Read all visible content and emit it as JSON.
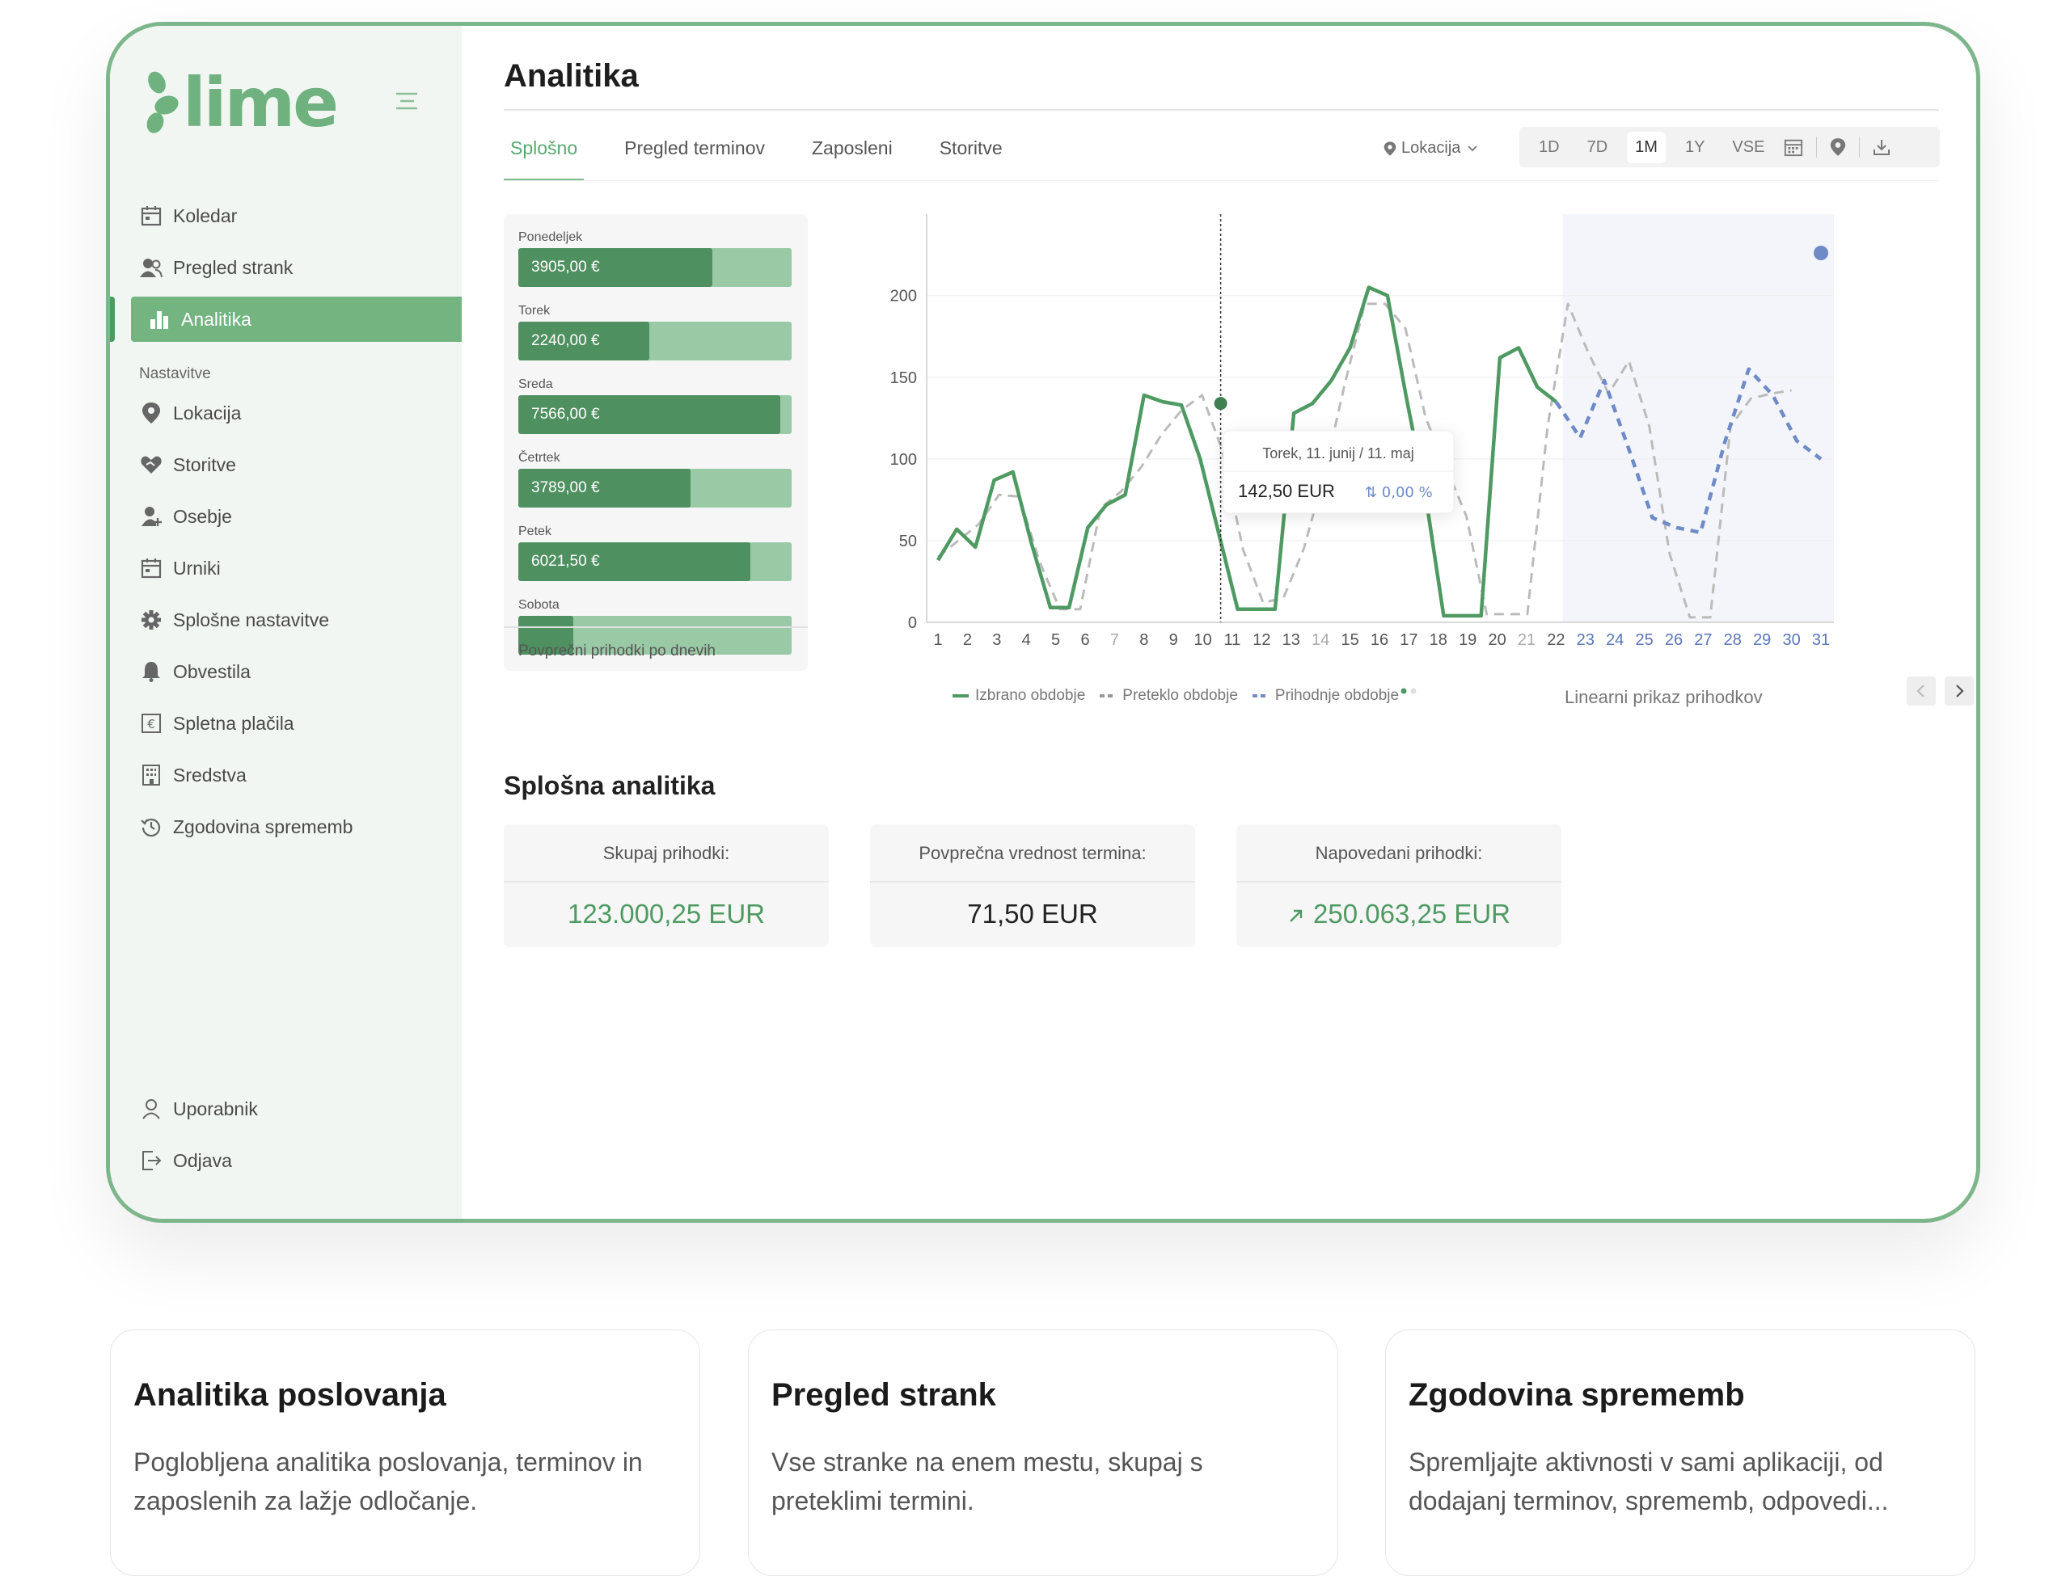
{
  "app": {
    "logo_text": "lime",
    "brand_color": "#6fb27f"
  },
  "sidebar": {
    "items": [
      {
        "label": "Koledar",
        "icon": "calendar-icon"
      },
      {
        "label": "Pregled strank",
        "icon": "users-icon"
      },
      {
        "label": "Analitika",
        "icon": "bar-chart-icon",
        "active": true
      }
    ],
    "section_label": "Nastavitve",
    "settings_items": [
      {
        "label": "Lokacija",
        "icon": "location-pin-icon"
      },
      {
        "label": "Storitve",
        "icon": "heart-hand-icon"
      },
      {
        "label": "Osebje",
        "icon": "user-plus-icon"
      },
      {
        "label": "Urniki",
        "icon": "calendar-icon"
      },
      {
        "label": "Splošne nastavitve",
        "icon": "gear-icon"
      },
      {
        "label": "Obvestila",
        "icon": "bell-icon"
      },
      {
        "label": "Spletna plačila",
        "icon": "euro-icon"
      },
      {
        "label": "Sredstva",
        "icon": "building-icon"
      },
      {
        "label": "Zgodovina sprememb",
        "icon": "history-icon"
      }
    ],
    "bottom_items": [
      {
        "label": "Uporabnik",
        "icon": "user-icon"
      },
      {
        "label": "Odjava",
        "icon": "logout-icon"
      }
    ]
  },
  "main": {
    "title": "Analitika",
    "tabs": [
      "Splošno",
      "Pregled terminov",
      "Zaposleni",
      "Storitve"
    ],
    "active_tab": "Splošno",
    "location_label": "Lokacija",
    "ranges": [
      "1D",
      "7D",
      "1M",
      "1Y",
      "VSE"
    ],
    "active_range": "1M",
    "days_panel": {
      "items": [
        {
          "label": "Ponedeljek",
          "value": "3905,00 €",
          "fraction": 0.71
        },
        {
          "label": "Torek",
          "value": "2240,00 €",
          "fraction": 0.48
        },
        {
          "label": "Sreda",
          "value": "7566,00 €",
          "fraction": 0.96
        },
        {
          "label": "Četrtek",
          "value": "3789,00 €",
          "fraction": 0.63
        },
        {
          "label": "Petek",
          "value": "6021,50 €",
          "fraction": 0.85
        },
        {
          "label": "Sobota",
          "value": "",
          "fraction": 0.2
        }
      ],
      "footer": "Povprečni prihodki po dnevih"
    },
    "legend": [
      "Izbrano obdobje",
      "Preteklo obdobje",
      "Prihodnje obdobje"
    ],
    "linear_label": "Linearni prikaz prihodkov",
    "tooltip": {
      "date": "Torek, 11. junij / 11. maj",
      "value": "142,50 EUR",
      "change": "0,00 %"
    },
    "general_title": "Splošna analitika",
    "stats": [
      {
        "label": "Skupaj prihodki:",
        "value": "123.000,25 EUR",
        "color": "#4e9a62"
      },
      {
        "label": "Povprečna vrednost termina:",
        "value": "71,50 EUR",
        "color": "#222222"
      },
      {
        "label": "Napovedani prihodki:",
        "value": "250.063,25 EUR",
        "color": "#4e9a62"
      }
    ]
  },
  "chart_data": {
    "type": "line",
    "x": [
      1,
      2,
      3,
      4,
      5,
      6,
      7,
      8,
      9,
      10,
      11,
      12,
      13,
      14,
      15,
      16,
      17,
      18,
      19,
      20,
      21,
      22,
      23,
      24,
      25,
      26,
      27,
      28,
      29,
      30,
      31
    ],
    "ylim": [
      0,
      230
    ],
    "yticks": [
      0,
      50,
      100,
      150,
      200
    ],
    "series": [
      {
        "name": "Izbrano obdobje",
        "color": "#4e9a62",
        "style": "solid",
        "values": [
          38,
          57,
          46,
          87,
          92,
          48,
          9,
          9,
          58,
          72,
          78,
          139,
          135,
          133,
          100,
          54,
          8,
          8,
          8,
          128,
          134,
          148,
          168,
          205,
          200,
          138,
          80,
          4,
          4,
          4,
          162,
          168,
          144,
          135
        ]
      },
      {
        "name": "Preteklo obdobje",
        "color": "#bbbbbb",
        "style": "dashed",
        "values": [
          40,
          50,
          60,
          78,
          77,
          37,
          8,
          8,
          70,
          80,
          95,
          115,
          130,
          139,
          105,
          45,
          12,
          15,
          45,
          90,
          145,
          195,
          195,
          180,
          125,
          95,
          65,
          5,
          5,
          5,
          120,
          195,
          165,
          140,
          160,
          120,
          42,
          3,
          3,
          120,
          137,
          140,
          142
        ]
      },
      {
        "name": "Prihodnje obdobje",
        "color": "#6e8bc7",
        "style": "dashed",
        "values": [
          135,
          113,
          148,
          107,
          64,
          58,
          55,
          110,
          155,
          139,
          111,
          100
        ]
      }
    ],
    "highlight_x": 10
  },
  "features": [
    {
      "title": "Analitika poslovanja",
      "text": "Poglobljena analitika poslovanja, terminov in zaposlenih za lažje odločanje."
    },
    {
      "title": "Pregled strank",
      "text": "Vse stranke na enem mestu, skupaj s preteklimi termini."
    },
    {
      "title": "Zgodovina sprememb",
      "text": "Spremljajte aktivnosti v sami aplikaciji, od dodajanj terminov, sprememb, odpovedi..."
    }
  ]
}
